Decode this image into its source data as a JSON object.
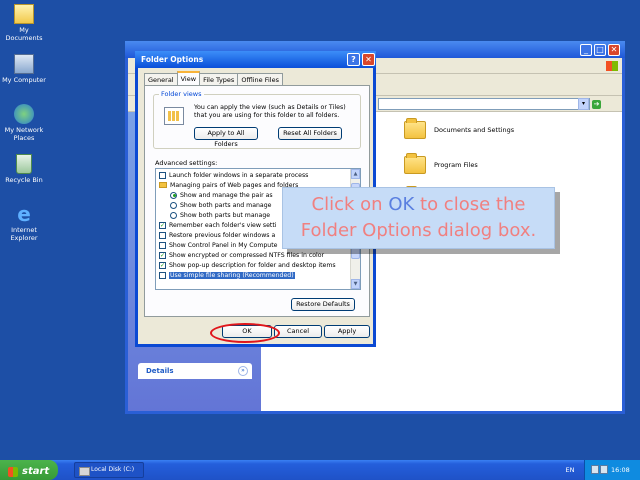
{
  "desktop": {
    "icons": [
      {
        "label": "My Documents"
      },
      {
        "label": "My Computer"
      },
      {
        "label_line1": "My Network",
        "label_line2": "Places"
      },
      {
        "label": "Recycle Bin"
      },
      {
        "label_line1": "Internet",
        "label_line2": "Explorer"
      }
    ]
  },
  "explorer": {
    "folders": [
      "Documents and Settings",
      "Program Files"
    ],
    "details_label": "Details"
  },
  "dialog": {
    "title": "Folder Options",
    "tabs": [
      "General",
      "View",
      "File Types",
      "Offline Files"
    ],
    "active_tab": "View",
    "folder_views": {
      "legend": "Folder views",
      "description": "You can apply the view (such as Details or Tiles) that you are using for this folder to all folders.",
      "apply_button": "Apply to All Folders",
      "reset_button": "Reset All Folders"
    },
    "advanced_label": "Advanced settings:",
    "advanced_items": [
      {
        "type": "checkbox",
        "checked": false,
        "text": "Launch folder windows in a separate process"
      },
      {
        "type": "folder",
        "text": "Managing pairs of Web pages and folders"
      },
      {
        "type": "radio",
        "checked": true,
        "text": "Show and manage the pair as"
      },
      {
        "type": "radio",
        "checked": false,
        "text": "Show both parts and manage"
      },
      {
        "type": "radio",
        "checked": false,
        "text": "Show both parts but manage"
      },
      {
        "type": "checkbox",
        "checked": true,
        "text": "Remember each folder's view setti"
      },
      {
        "type": "checkbox",
        "checked": false,
        "text": "Restore previous folder windows a"
      },
      {
        "type": "checkbox",
        "checked": false,
        "text": "Show Control Panel in My Compute"
      },
      {
        "type": "checkbox",
        "checked": true,
        "text": "Show encrypted or compressed NTFS files in color"
      },
      {
        "type": "checkbox",
        "checked": true,
        "text": "Show pop-up description for folder and desktop items"
      },
      {
        "type": "checkbox",
        "checked": false,
        "selected": true,
        "text": "Use simple file sharing (Recommended)"
      }
    ],
    "check_mark": "✓",
    "restore_button": "Restore Defaults",
    "ok_button": "OK",
    "cancel_button": "Cancel",
    "apply_button": "Apply",
    "help_glyph": "?",
    "close_glyph": "✕"
  },
  "callout": {
    "part1": "Click on ",
    "highlight": "OK",
    "part2": " to close the Folder Options dialog box."
  },
  "taskbar": {
    "start_label": "start",
    "task_item": "Local Disk (C:)",
    "language": "EN",
    "clock": "16:08"
  }
}
